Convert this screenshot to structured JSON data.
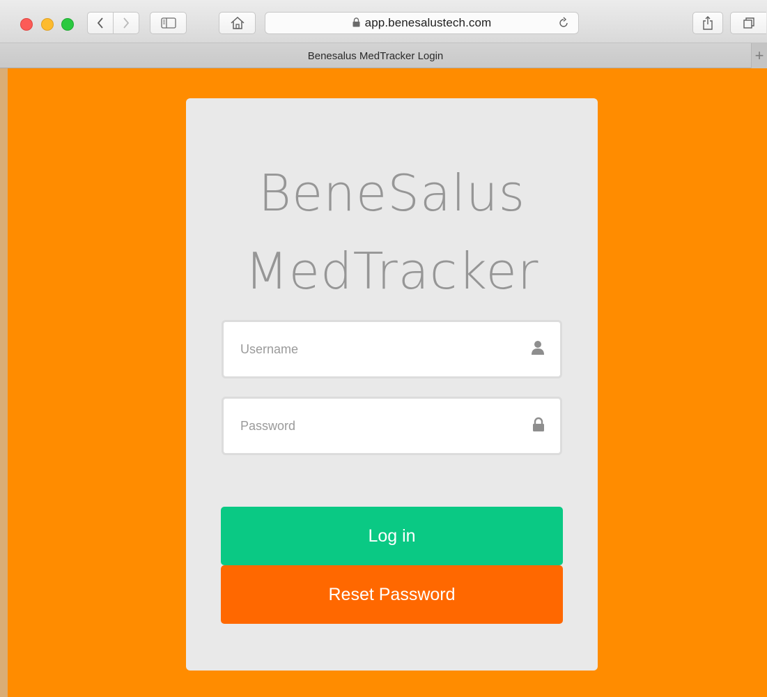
{
  "browser": {
    "url": "app.benesalustech.com",
    "tab_title": "Benesalus MedTracker Login",
    "new_tab_symbol": "+"
  },
  "login": {
    "logo_line1": "BeneSalus",
    "logo_line2": "MedTracker",
    "username_placeholder": "Username",
    "password_placeholder": "Password",
    "login_label": "Log in",
    "reset_label": "Reset Password"
  },
  "colors": {
    "page_background": "#ff8c00",
    "card_background": "#e9e9e9",
    "login_button": "#0ac984",
    "reset_button": "#ff6800",
    "logo_text": "#969696"
  },
  "icons": {
    "username_field": "user-icon",
    "password_field": "lock-icon",
    "address_bar": "lock-icon",
    "reload": "reload-icon",
    "home": "home-icon",
    "share": "share-icon",
    "tabs": "tabs-icon",
    "sidebar": "sidebar-icon"
  }
}
